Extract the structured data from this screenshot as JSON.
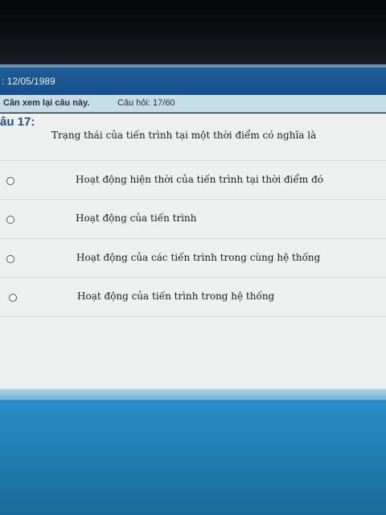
{
  "header": {
    "date_text": ": 12/05/1989"
  },
  "subheader": {
    "review_label": "Cần xem lại câu này.",
    "counter_text": "Câu hỏi: 17/60"
  },
  "question": {
    "number_label": "âu 17:",
    "text": "Trạng thái của tiến trình tại một thời điểm có nghĩa là"
  },
  "options": [
    {
      "label": "Hoạt động hiện thời của tiến trình tại thời điểm đó",
      "selected": false
    },
    {
      "label": "Hoạt động của tiến trình",
      "selected": false
    },
    {
      "label": "Hoạt động của các tiến trình trong cùng hệ thống",
      "selected": false
    },
    {
      "label": "Hoạt động của tiến trình trong hệ thống",
      "selected": false
    }
  ],
  "colors": {
    "titlebar": "#17508a",
    "subheader": "#c7dde6",
    "content_bg": "#eef0ef",
    "lower_area": "#1f79ad"
  }
}
